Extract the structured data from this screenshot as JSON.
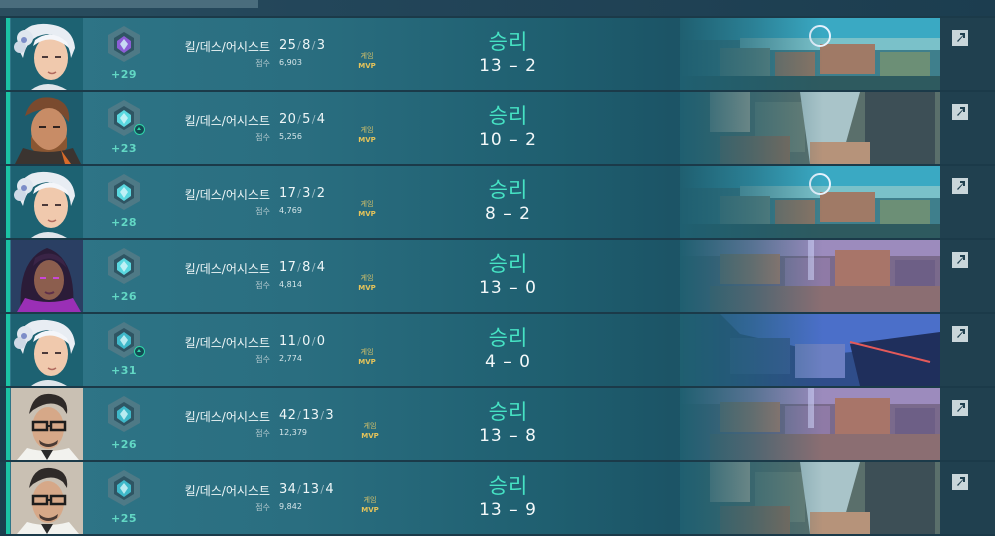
{
  "labels": {
    "kda_label": "킬/데스/어시스트",
    "score_label": "점수",
    "mvp_line1": "게임",
    "mvp_line2": "MVP",
    "score_dash": "–"
  },
  "colors": {
    "win_accent": "#1bc3a5",
    "result_text": "#46e3c4",
    "mvp_gold": "#e4c35a",
    "rr_gain": "#62d7c4"
  },
  "matches": [
    {
      "agent": "jett",
      "rank_icon": "purple-rank-icon",
      "rank_color": "#8c5ed6",
      "rr": "+29",
      "kills": "25",
      "deaths": "8",
      "assists": "3",
      "score": "6,903",
      "result": "승리",
      "team_score": "13",
      "enemy_score": "2",
      "map": "map-a",
      "rank_up": false
    },
    {
      "agent": "brimstone-like",
      "rank_icon": "diamond-rank-icon",
      "rank_color": "#5ad8e0",
      "rr": "+23",
      "kills": "20",
      "deaths": "5",
      "assists": "4",
      "score": "5,256",
      "result": "승리",
      "team_score": "10",
      "enemy_score": "2",
      "map": "map-b",
      "rank_up": true
    },
    {
      "agent": "jett",
      "rank_icon": "diamond-rank-icon",
      "rank_color": "#5ad8e0",
      "rr": "+28",
      "kills": "17",
      "deaths": "3",
      "assists": "2",
      "score": "4,769",
      "result": "승리",
      "team_score": "8",
      "enemy_score": "2",
      "map": "map-a",
      "rank_up": false
    },
    {
      "agent": "reyna",
      "rank_icon": "diamond-rank-icon",
      "rank_color": "#5ad8e0",
      "rr": "+26",
      "kills": "17",
      "deaths": "8",
      "assists": "4",
      "score": "4,814",
      "result": "승리",
      "team_score": "13",
      "enemy_score": "0",
      "map": "map-c",
      "rank_up": false
    },
    {
      "agent": "jett",
      "rank_icon": "platinum-rank-icon",
      "rank_color": "#3fb8c9",
      "rr": "+31",
      "kills": "11",
      "deaths": "0",
      "assists": "0",
      "score": "2,774",
      "result": "승리",
      "team_score": "4",
      "enemy_score": "0",
      "map": "map-d",
      "rank_up": true
    },
    {
      "agent": "chamber",
      "rank_icon": "platinum-rank-icon",
      "rank_color": "#3fb8c9",
      "rr": "+26",
      "kills": "42",
      "deaths": "13",
      "assists": "3",
      "score": "12,379",
      "result": "승리",
      "team_score": "13",
      "enemy_score": "8",
      "map": "map-c",
      "rank_up": false
    },
    {
      "agent": "chamber",
      "rank_icon": "platinum-rank-icon",
      "rank_color": "#3fb8c9",
      "rr": "+25",
      "kills": "34",
      "deaths": "13",
      "assists": "4",
      "score": "9,842",
      "result": "승리",
      "team_score": "13",
      "enemy_score": "9",
      "map": "map-b",
      "rank_up": false
    }
  ]
}
